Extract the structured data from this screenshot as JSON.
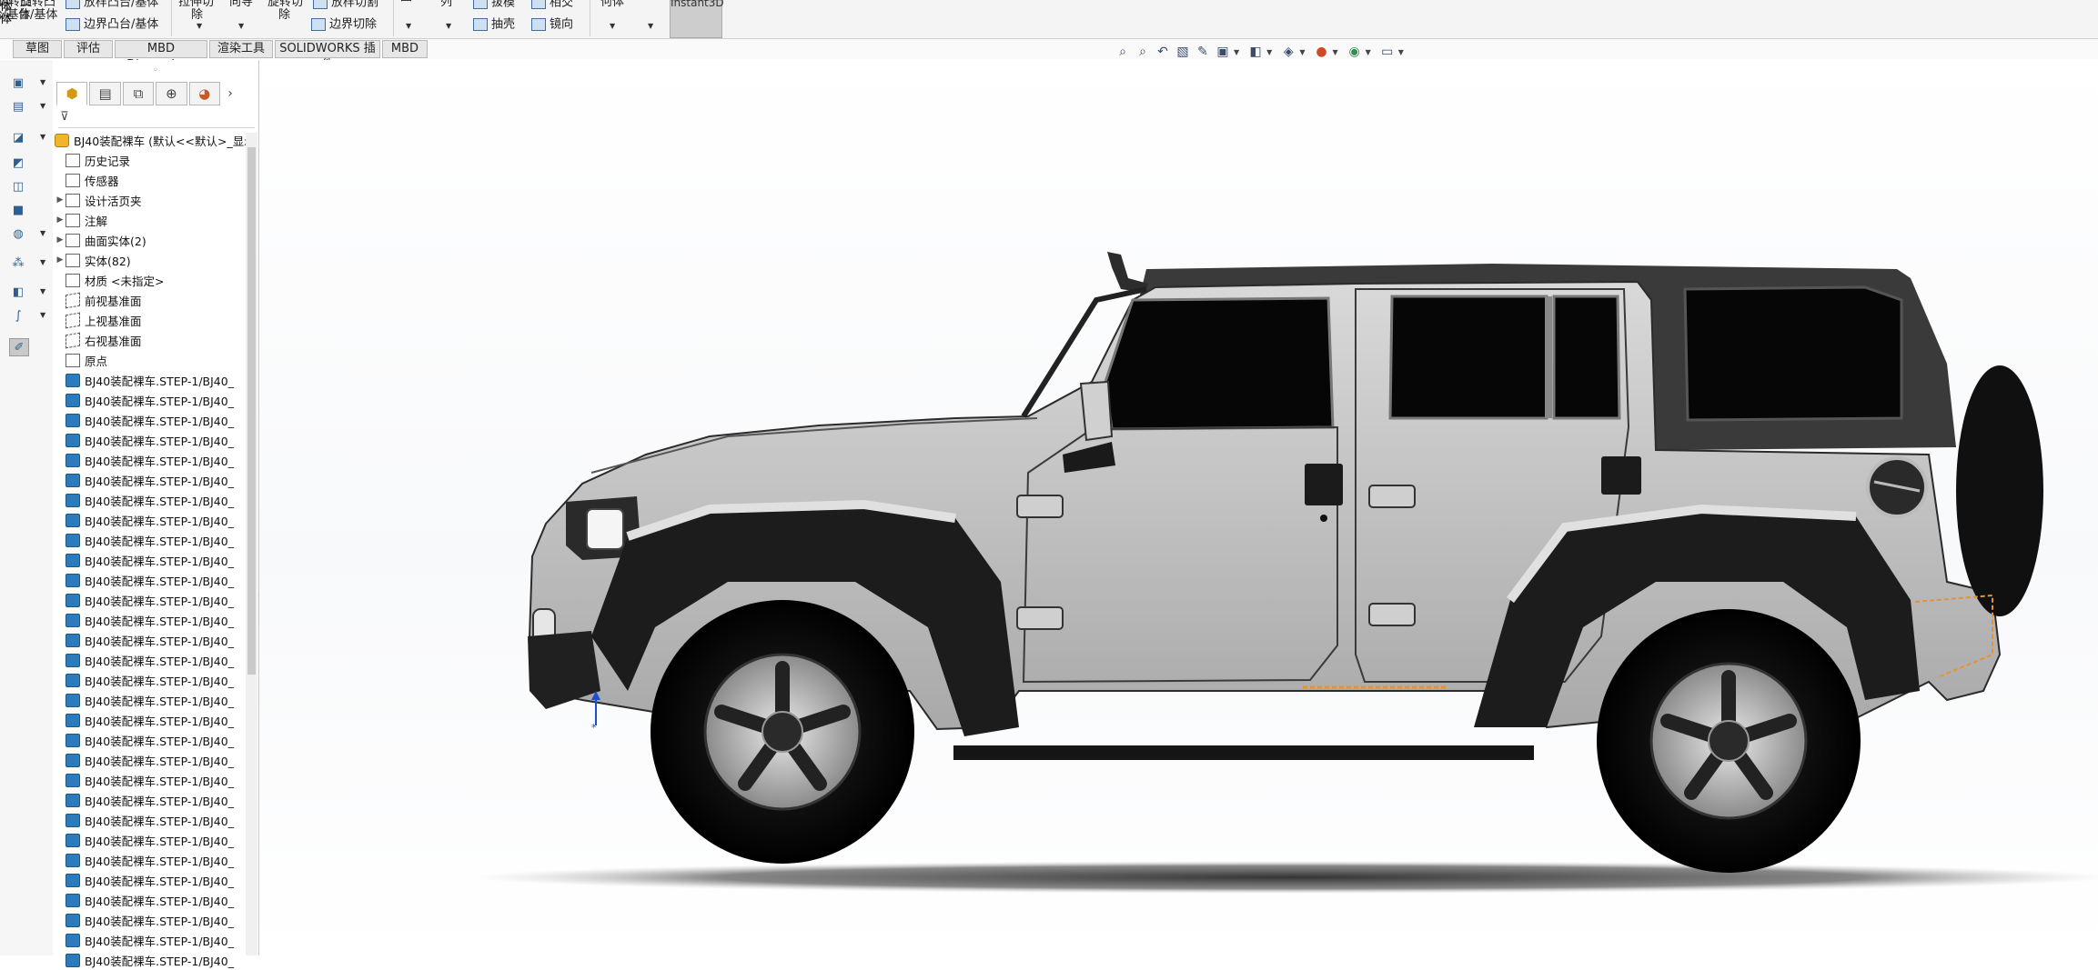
{
  "ribbon": {
    "revolve_boss": "旋转凸台/基体",
    "revolve_boss_top": "旋转凸",
    "revolve_boss_bottom": "台/基体",
    "sweep_boss": "扫描凸台/基体",
    "loft_boss": "放样凸台/基体",
    "boundary_boss": "边界凸台/基体",
    "extrude_cut": "拉伸切除",
    "extrude_cut_top": "拉伸切",
    "extrude_cut_bottom": "除",
    "hole_wizard_top": "异型孔",
    "hole_wizard_bottom": "向导",
    "revolve_cut_top": "旋转切",
    "revolve_cut_bottom": "除",
    "loft_cut": "放样切割",
    "boundary_cut": "边界切除",
    "linear_pattern": "线性阵列",
    "linear_pattern_bottom": "列",
    "draft": "拔模",
    "shell": "抽壳",
    "intersect": "相交",
    "mirror": "镜向",
    "ref_geometry_bottom": "何体",
    "instant3d": "Instant3D"
  },
  "tabs": [
    "草图",
    "评估",
    "MBD Dimensions",
    "渲染工具",
    "SOLIDWORKS 插件",
    "MBD"
  ],
  "hud_icons": [
    "zoom-fit-icon",
    "zoom-area-icon",
    "previous-view-icon",
    "section-view-icon",
    "dynamic-annotation-icon",
    "view-orientation-icon",
    "display-style-icon",
    "hide-show-icon",
    "edit-appearance-icon",
    "scene-icon",
    "view-settings-icon"
  ],
  "featuremanager": {
    "panel_tabs": [
      "featuremanager-tab",
      "propertymanager-tab",
      "configurationmanager-tab",
      "dimxpert-tab",
      "display-manager-tab"
    ],
    "root": "BJ40装配裸车  (默认<<默认>_显示",
    "items": [
      {
        "label": "历史记录",
        "icon": "history-icon",
        "expand": false
      },
      {
        "label": "传感器",
        "icon": "sensor-icon",
        "expand": false
      },
      {
        "label": "设计活页夹",
        "icon": "design-binder-icon",
        "expand": true
      },
      {
        "label": "注解",
        "icon": "annotations-icon",
        "expand": true
      },
      {
        "label": "曲面实体(2)",
        "icon": "surface-bodies-icon",
        "expand": true
      },
      {
        "label": "实体(82)",
        "icon": "solid-bodies-icon",
        "expand": true
      },
      {
        "label": "材质 <未指定>",
        "icon": "material-icon",
        "expand": false
      },
      {
        "label": "前视基准面",
        "icon": "plane-icon",
        "expand": false
      },
      {
        "label": "上视基准面",
        "icon": "plane-icon",
        "expand": false
      },
      {
        "label": "右视基准面",
        "icon": "plane-icon",
        "expand": false
      },
      {
        "label": "原点",
        "icon": "origin-icon",
        "expand": false
      }
    ],
    "part_label": "BJ40装配裸车.STEP-1/BJ40_"
  },
  "colors": {
    "accent": "#2b7bbd",
    "body_paint": "#c4c4c4",
    "roof": "#3a3a3a",
    "selection_orange": "#e8912d"
  }
}
